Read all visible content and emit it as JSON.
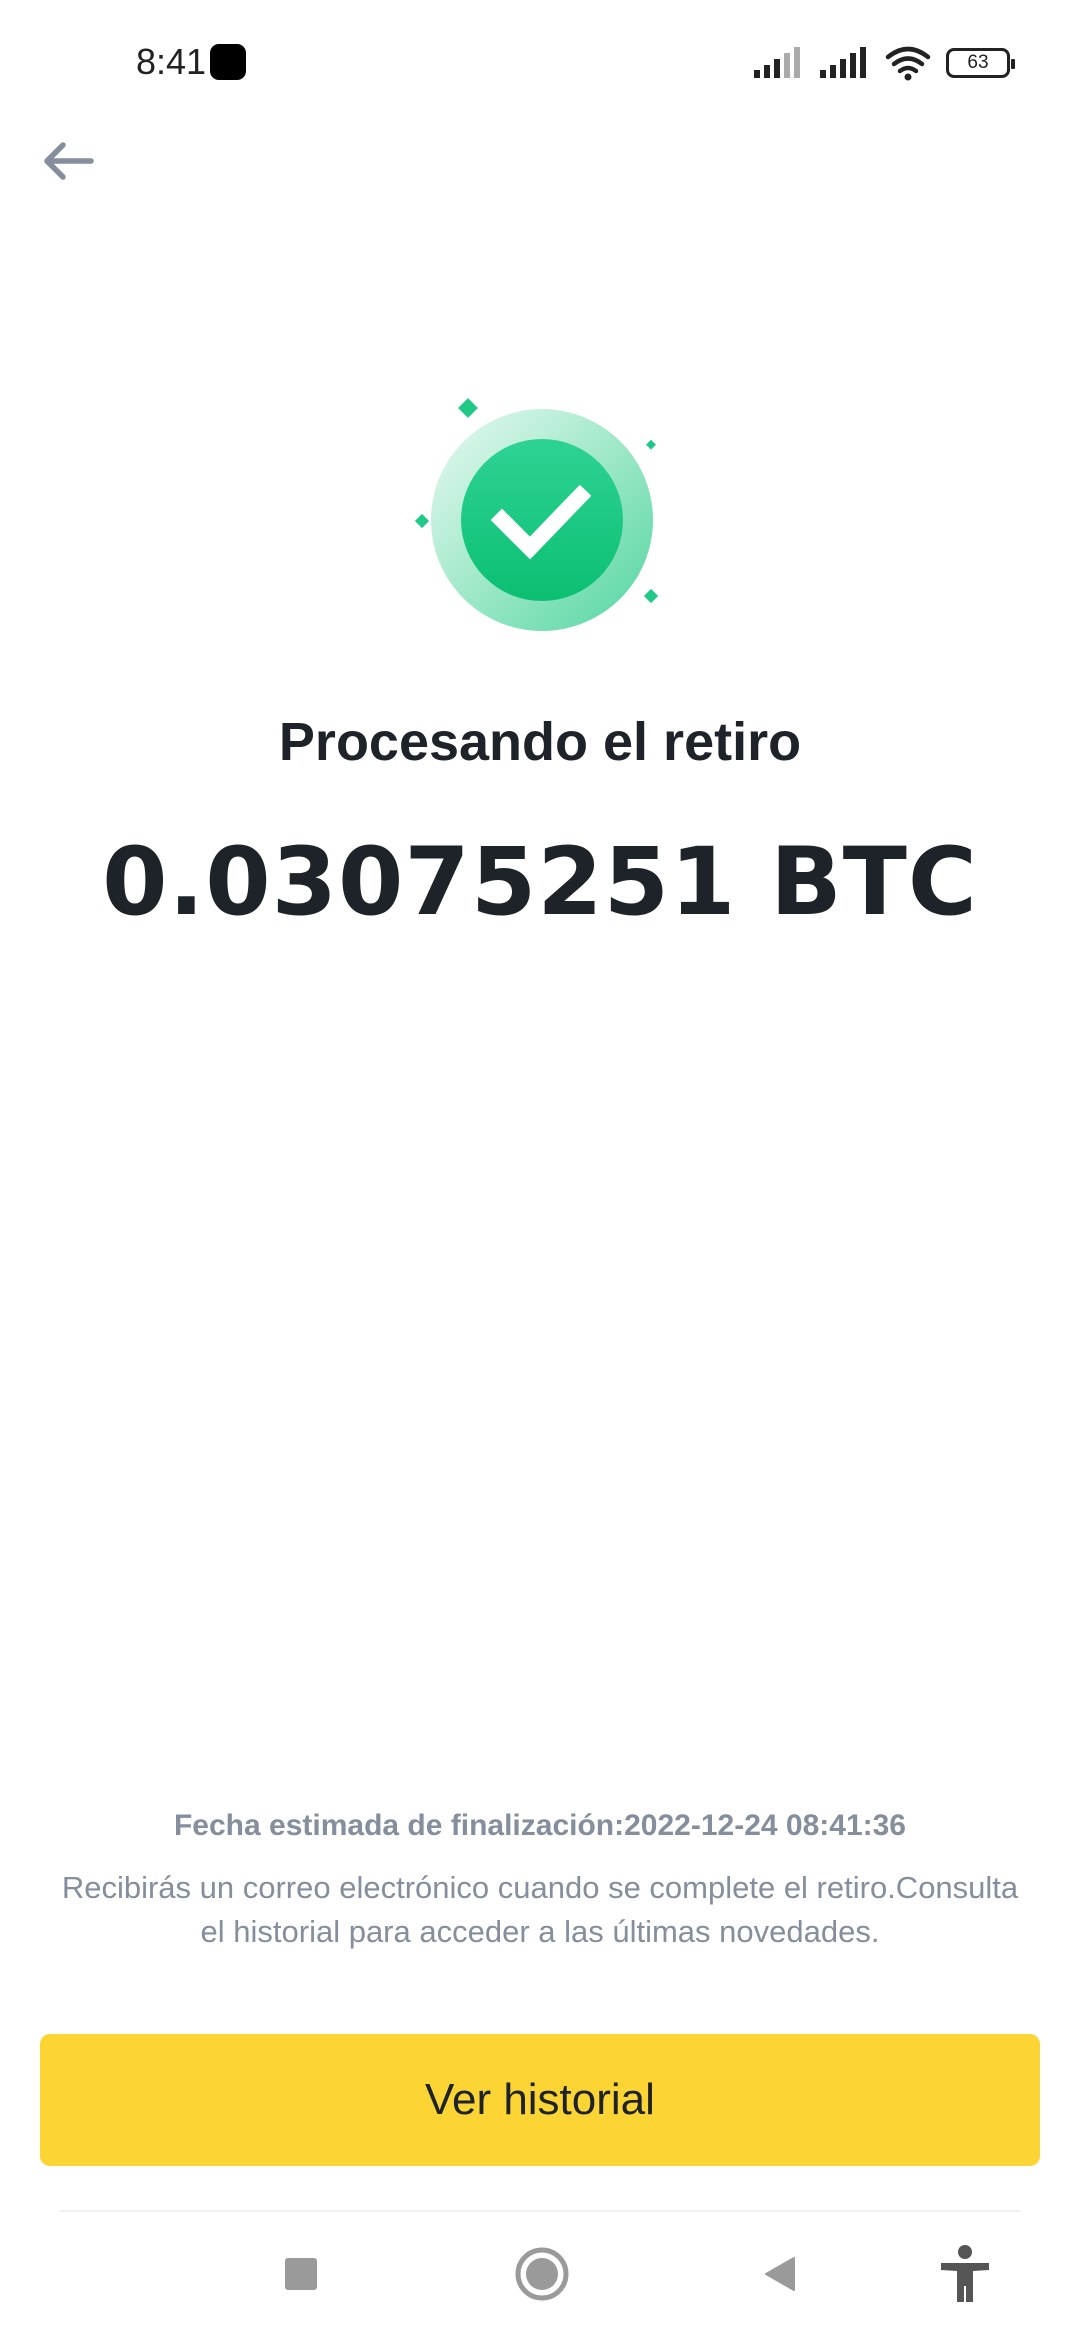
{
  "status_bar": {
    "time": "8:41",
    "battery": "63"
  },
  "icons": {
    "back": "arrow-left-icon",
    "success": "check-circle-icon",
    "signal": "signal-icon",
    "wifi": "wifi-icon",
    "battery": "battery-icon",
    "nav_recents": "square-icon",
    "nav_home": "circle-icon",
    "nav_back": "triangle-left-icon",
    "accessibility": "accessibility-icon"
  },
  "main": {
    "title": "Procesando el retiro",
    "amount": "0.03075251 BTC",
    "eta": "Fecha estimada de finalización:2022-12-24 08:41:36",
    "note": "Recibirás un correo electrónico cuando se complete el retiro.Consulta el historial para acceder a las últimas novedades."
  },
  "actions": {
    "history_label": "Ver historial"
  },
  "colors": {
    "accent": "#fcd535",
    "success": "#0ecb81",
    "text_primary": "#1e2329",
    "text_secondary": "#848e9c"
  }
}
